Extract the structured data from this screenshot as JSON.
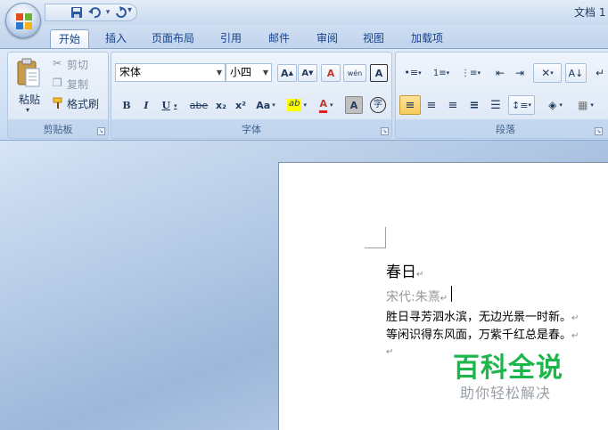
{
  "title_bar": {
    "doc_title": "文档 1"
  },
  "tabs": [
    {
      "label": "开始",
      "active": true
    },
    {
      "label": "插入"
    },
    {
      "label": "页面布局"
    },
    {
      "label": "引用"
    },
    {
      "label": "邮件"
    },
    {
      "label": "审阅"
    },
    {
      "label": "视图"
    },
    {
      "label": "加载项"
    }
  ],
  "clipboard": {
    "label": "剪贴板",
    "paste": "粘贴",
    "cut": "剪切",
    "copy": "复制",
    "format_painter": "格式刷"
  },
  "font": {
    "label": "字体",
    "font_name": "宋体",
    "font_size": "小四",
    "grow": "A",
    "shrink": "A",
    "clear_format": "A",
    "phonetic": "wén",
    "char_border": "A",
    "bold": "B",
    "italic": "I",
    "underline": "U",
    "strikethrough": "abe",
    "subscript": "x₂",
    "superscript": "x²",
    "change_case": "Aa",
    "highlight": "ab",
    "font_color": "A",
    "char_shading": "A",
    "enclose": "字"
  },
  "paragraph": {
    "label": "段落"
  },
  "document": {
    "lines": [
      {
        "text": "春日",
        "mark": "↵"
      },
      {
        "text": "宋代:朱熹",
        "mark": "↵"
      },
      {
        "text": "胜日寻芳泗水滨，无边光景一时新。",
        "mark": "↵"
      },
      {
        "text": "等闲识得东风面，万紫千红总是春。",
        "mark": "↵"
      },
      {
        "text": "",
        "mark": "↵"
      }
    ]
  },
  "watermark": {
    "title": "百科全说",
    "subtitle": "助你轻松解决"
  },
  "colors": {
    "highlight": "#ffff00",
    "font_color": "#e0201e",
    "watermark": "#1db64a"
  }
}
